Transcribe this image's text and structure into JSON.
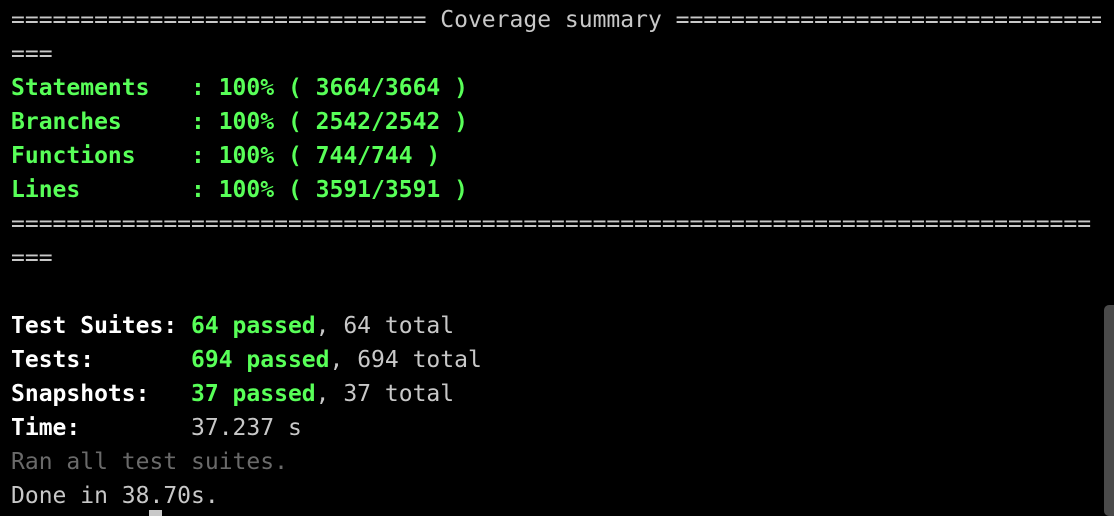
{
  "summary": {
    "header_rule": "============================== Coverage summary ===============================",
    "header_wrap": "===",
    "rows": [
      {
        "label": "Statements   ",
        "value": ": 100% ( 3664/3664 )"
      },
      {
        "label": "Branches     ",
        "value": ": 100% ( 2542/2542 )"
      },
      {
        "label": "Functions    ",
        "value": ": 100% ( 744/744 )"
      },
      {
        "label": "Lines        ",
        "value": ": 100% ( 3591/3591 )"
      }
    ],
    "footer_rule": "==============================================================================",
    "footer_wrap": "==="
  },
  "results": {
    "suites": {
      "label": "Test Suites: ",
      "passed": "64 passed",
      "total": ", 64 total"
    },
    "tests": {
      "label": "Tests:       ",
      "passed": "694 passed",
      "total": ", 694 total"
    },
    "snapshots": {
      "label": "Snapshots:   ",
      "passed": "37 passed",
      "total": ", 37 total"
    },
    "time": {
      "label": "Time:        ",
      "value": "37.237 s"
    },
    "ran_all": "Ran all test suites.",
    "done": "Done in 38.70s."
  },
  "colors": {
    "background": "#000000",
    "success": "#58ff58",
    "text": "#c8c8c8",
    "dim": "#6a6a6a"
  }
}
